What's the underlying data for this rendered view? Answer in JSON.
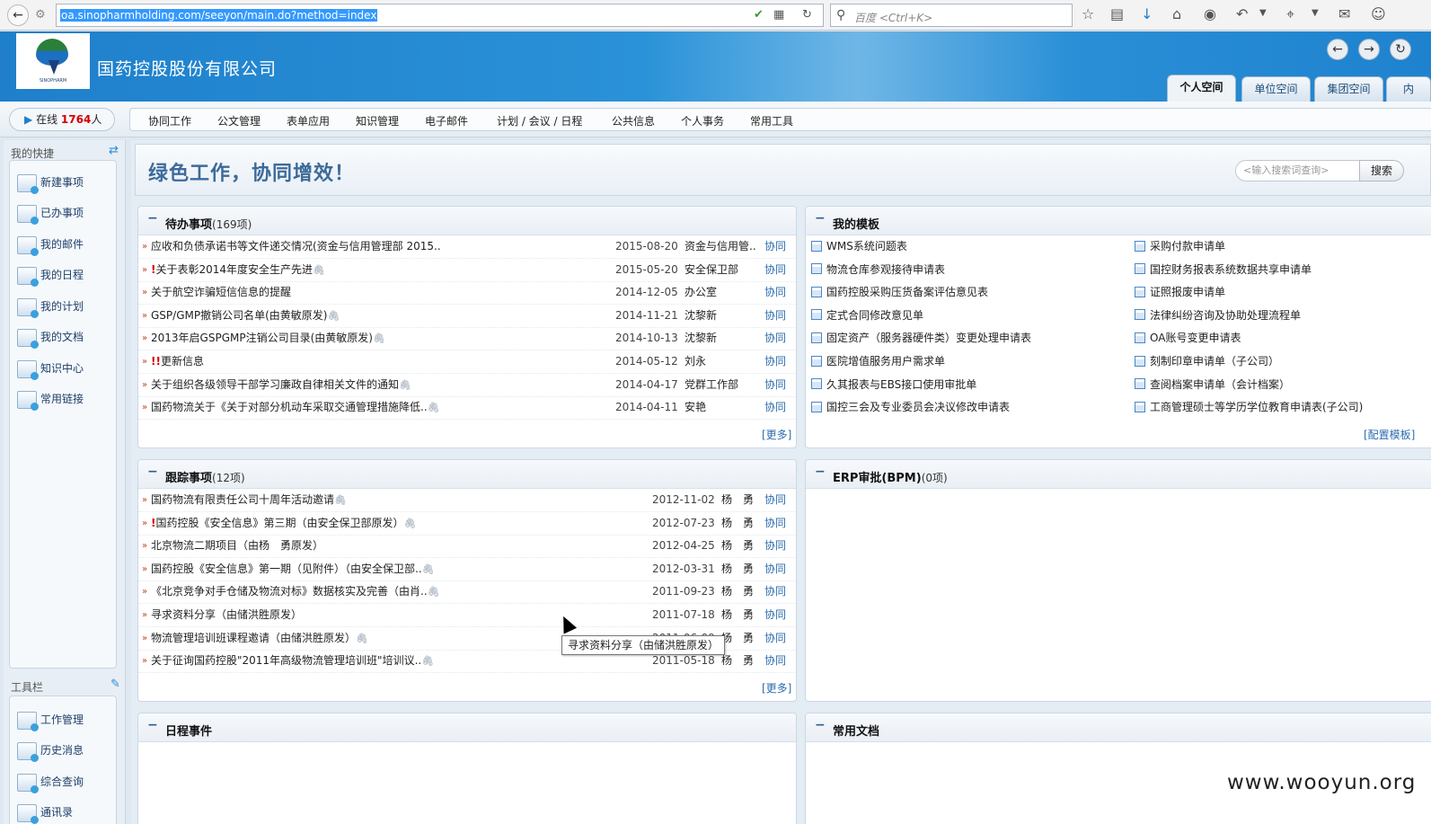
{
  "browser": {
    "url": "oa.sinopharmholding.com/seeyon/main.do?method=index",
    "search_placeholder": "百度 <Ctrl+K>",
    "icons": [
      "back-icon",
      "reload-icon",
      "shield-icon",
      "qr-icon",
      "search-icon",
      "star-icon",
      "reader-icon",
      "download-icon",
      "home-icon",
      "chat-icon",
      "undo-icon",
      "crop-icon",
      "comment-icon",
      "user-icon"
    ]
  },
  "header": {
    "company": "国药控股股份有限公司",
    "logo_text": "SINOPHARM",
    "tabs": [
      "个人空间",
      "单位空间",
      "集团空间",
      "内"
    ],
    "active_tab": "个人空间"
  },
  "online": {
    "label": "在线",
    "count": "1764",
    "unit": "人"
  },
  "menu": [
    "协同工作",
    "公文管理",
    "表单应用",
    "知识管理",
    "电子邮件",
    "计划 / 会议 / 日程",
    "公共信息",
    "个人事务",
    "常用工具"
  ],
  "sidebar": {
    "shortcuts_title": "我的快捷",
    "shortcuts": [
      "新建事项",
      "已办事项",
      "我的邮件",
      "我的日程",
      "我的计划",
      "我的文档",
      "知识中心",
      "常用链接"
    ],
    "tools_title": "工具栏",
    "tools": [
      "工作管理",
      "历史消息",
      "综合查询",
      "通讯录"
    ]
  },
  "main": {
    "slogan": "绿色工作，协同增效！",
    "search_placeholder": "<输入搜索词查询>",
    "search_button": "搜索"
  },
  "pending": {
    "title": "待办事项",
    "count": "(169项)",
    "more": "[更多]",
    "rows": [
      {
        "title": "应收和负债承诺书等文件递交情况(资金与信用管理部 2015..",
        "imp": "",
        "clip": "",
        "date": "2015-08-20",
        "sender": "资金与信用管..",
        "type": "协同"
      },
      {
        "title": "关于表彰2014年度安全生产先进",
        "imp": "!",
        "clip": "🖇",
        "date": "2015-05-20",
        "sender": "安全保卫部",
        "type": "协同"
      },
      {
        "title": "关于航空诈骗短信信息的提醒",
        "imp": "",
        "clip": "",
        "date": "2014-12-05",
        "sender": "办公室",
        "type": "协同"
      },
      {
        "title": "GSP/GMP撤销公司名单(由黄敏原发)",
        "imp": "",
        "clip": "🖇",
        "date": "2014-11-21",
        "sender": "沈黎新",
        "type": "协同"
      },
      {
        "title": "2013年启GSPGMP注销公司目录(由黄敏原发)",
        "imp": "",
        "clip": "🖇",
        "date": "2014-10-13",
        "sender": "沈黎新",
        "type": "协同"
      },
      {
        "title": "更新信息",
        "imp": "!!",
        "clip": "",
        "date": "2014-05-12",
        "sender": "刘永",
        "type": "协同"
      },
      {
        "title": "关于组织各级领导干部学习廉政自律相关文件的通知",
        "imp": "",
        "clip": "🖇",
        "date": "2014-04-17",
        "sender": "党群工作部",
        "type": "协同"
      },
      {
        "title": "国药物流关于《关于对部分机动车采取交通管理措施降低..",
        "imp": "",
        "clip": "🖇",
        "date": "2014-04-11",
        "sender": "安艳",
        "type": "协同"
      }
    ]
  },
  "templates": {
    "title": "我的模板",
    "more": "[配置模板]",
    "left": [
      "WMS系统问题表",
      "物流仓库参观接待申请表",
      "国药控股采购压货备案评估意见表",
      "定式合同修改意见单",
      "固定资产（服务器硬件类）变更处理申请表",
      "医院增值服务用户需求单",
      "久其报表与EBS接口使用审批单",
      "国控三会及专业委员会决议修改申请表"
    ],
    "right": [
      "采购付款申请单",
      "国控财务报表系统数据共享申请单",
      "证照报废申请单",
      "法律纠纷咨询及协助处理流程单",
      "OA账号变更申请表",
      "刻制印章申请单（子公司）",
      "查阅档案申请单（会计档案）",
      "工商管理硕士等学历学位教育申请表(子公司)"
    ]
  },
  "tracking": {
    "title": "跟踪事项",
    "count": "(12项)",
    "more": "[更多]",
    "rows": [
      {
        "title": "国药物流有限责任公司十周年活动邀请",
        "imp": "",
        "clip": "🖇",
        "date": "2012-11-02",
        "sender": "杨　勇",
        "type": "协同"
      },
      {
        "title": "国药控股《安全信息》第三期（由安全保卫部原发）",
        "imp": "!",
        "clip": "🖇",
        "date": "2012-07-23",
        "sender": "杨　勇",
        "type": "协同"
      },
      {
        "title": "北京物流二期项目（由杨　勇原发）",
        "imp": "",
        "clip": "",
        "date": "2012-04-25",
        "sender": "杨　勇",
        "type": "协同"
      },
      {
        "title": "国药控股《安全信息》第一期（见附件）（由安全保卫部..",
        "imp": "",
        "clip": "🖇",
        "date": "2012-03-31",
        "sender": "杨　勇",
        "type": "协同"
      },
      {
        "title": "《北京竞争对手仓储及物流对标》数据核实及完善（由肖..",
        "imp": "",
        "clip": "🖇",
        "date": "2011-09-23",
        "sender": "杨　勇",
        "type": "协同"
      },
      {
        "title": "寻求资料分享（由储洪胜原发）",
        "imp": "",
        "clip": "",
        "date": "2011-07-18",
        "sender": "杨　勇",
        "type": "协同"
      },
      {
        "title": "物流管理培训班课程邀请（由储洪胜原发）",
        "imp": "",
        "clip": "🖇",
        "date": "2011-06-09",
        "sender": "杨　勇",
        "type": "协同"
      },
      {
        "title": "关于征询国药控股\"2011年高级物流管理培训班\"培训议..",
        "imp": "",
        "clip": "🖇",
        "date": "2011-05-18",
        "sender": "杨　勇",
        "type": "协同"
      }
    ]
  },
  "erp": {
    "title": "ERP审批(BPM)",
    "count": "(0项)"
  },
  "schedule": {
    "title": "日程事件"
  },
  "docs": {
    "title": "常用文档"
  },
  "tooltip": "寻求资料分享（由储洪胜原发）",
  "watermark": "www.wooyun.org"
}
